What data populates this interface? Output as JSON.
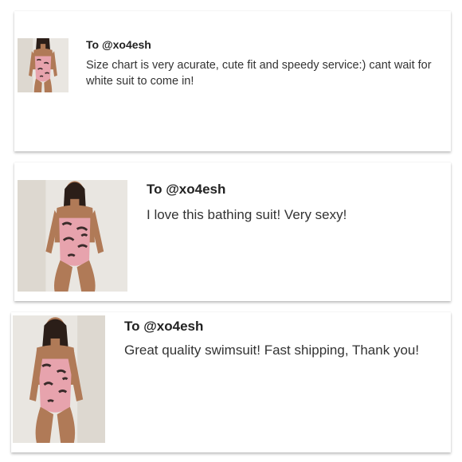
{
  "reviews": [
    {
      "recipient": "To @xo4esh",
      "text": "Size chart is very acurate, cute fit and speedy service:) cant wait for white suit to come in!",
      "photo_icon": "swimsuit-photo"
    },
    {
      "recipient": "To @xo4esh",
      "text": "I love this bathing suit! Very sexy!",
      "photo_icon": "swimsuit-photo"
    },
    {
      "recipient": "To @xo4esh",
      "text": "Great quality swimsuit! Fast shipping, Thank you!",
      "photo_icon": "swimsuit-photo"
    }
  ],
  "colors": {
    "suit_pink": "#e7a3ad",
    "snake_pattern": "#3a2b2a",
    "skin": "#b07a57",
    "background_wall": "#e9e6e1"
  }
}
